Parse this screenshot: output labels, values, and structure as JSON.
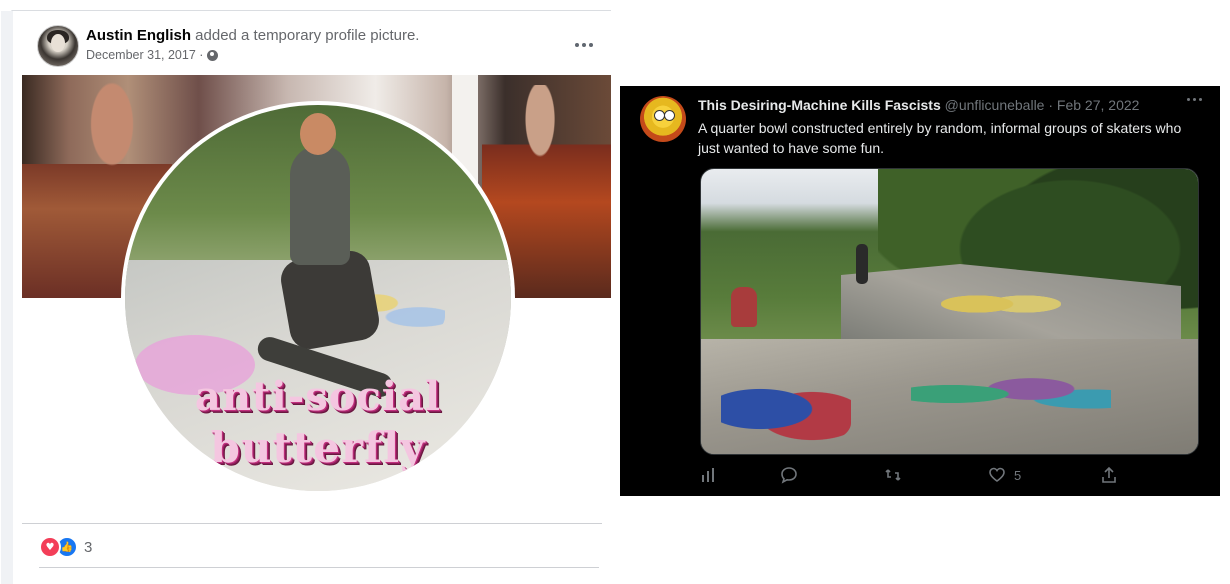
{
  "facebook_post": {
    "author": "Austin English",
    "action_text": " added a temporary profile picture.",
    "date": "December 31, 2017 ·",
    "privacy_icon": "globe-icon",
    "more_icon": "more-options-icon",
    "sticker_line_1": "anti-social",
    "sticker_line_2": "butterfly",
    "reaction_icons": [
      "love-icon",
      "like-icon"
    ],
    "reaction_count": "3"
  },
  "tweet": {
    "display_name": "This Desiring-Machine Kills Fascists",
    "handle_and_date": " @unflicuneballe · Feb 27, 2022",
    "text": "A quarter bowl constructed entirely by random, informal groups of skaters who just wanted to have some fun.",
    "more_icon": "more-options-icon",
    "actions": {
      "analytics_icon": "analytics-icon",
      "reply_icon": "reply-icon",
      "retweet_icon": "retweet-icon",
      "like_icon": "heart-icon",
      "like_count": "5",
      "share_icon": "share-icon"
    }
  }
}
